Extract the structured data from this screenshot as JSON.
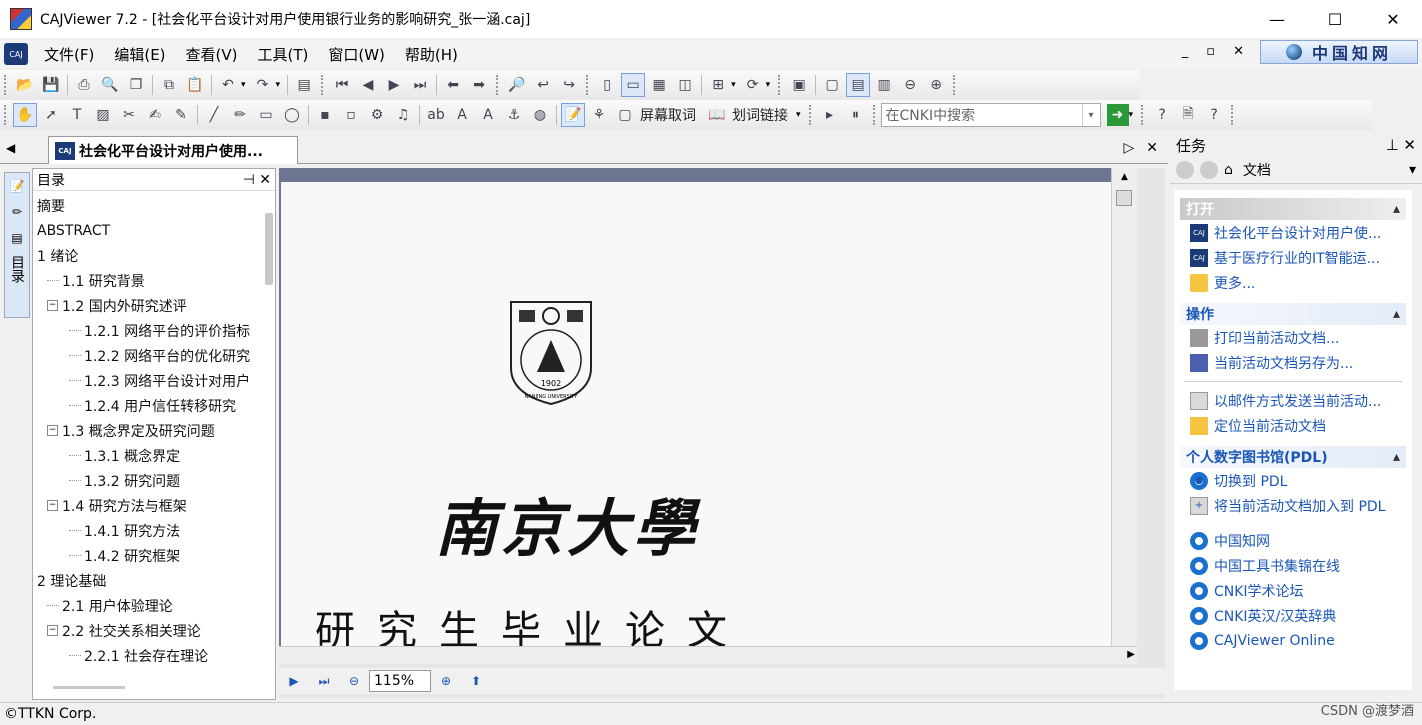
{
  "window": {
    "title": "CAJViewer 7.2 - [社会化平台设计对用户使用银行业务的影响研究_张一涵.caj]",
    "controls": [
      "—",
      "☐",
      "✕"
    ]
  },
  "menu": {
    "items": [
      "文件(F)",
      "编辑(E)",
      "查看(V)",
      "工具(T)",
      "窗口(W)",
      "帮助(H)"
    ],
    "mdi_controls": [
      "_",
      "▫",
      "✕"
    ],
    "brand": "中国知网"
  },
  "toolbar2": {
    "screen_select": "屏幕取词",
    "word_link": "划词链接",
    "search_placeholder": "在CNKI中搜索"
  },
  "doc_tab": {
    "title": "社会化平台设计对用户使用...",
    "icon_text": "CAJ"
  },
  "side_tabs": {
    "toc_label": "目录"
  },
  "toc": {
    "title": "目录",
    "items": [
      {
        "label": "摘要",
        "level": 0
      },
      {
        "label": "ABSTRACT",
        "level": 0
      },
      {
        "label": "1 绪论",
        "level": 0
      },
      {
        "label": "1.1 研究背景",
        "level": 1
      },
      {
        "label": "1.2 国内外研究述评",
        "level": 1,
        "expander": "−"
      },
      {
        "label": "1.2.1 网络平台的评价指标",
        "level": 2
      },
      {
        "label": "1.2.2 网络平台的优化研究",
        "level": 2
      },
      {
        "label": "1.2.3 网络平台设计对用户",
        "level": 2
      },
      {
        "label": "1.2.4 用户信任转移研究",
        "level": 2
      },
      {
        "label": "1.3 概念界定及研究问题",
        "level": 1,
        "expander": "−"
      },
      {
        "label": "1.3.1 概念界定",
        "level": 2
      },
      {
        "label": "1.3.2 研究问题",
        "level": 2
      },
      {
        "label": "1.4 研究方法与框架",
        "level": 1,
        "expander": "−"
      },
      {
        "label": "1.4.1 研究方法",
        "level": 2
      },
      {
        "label": "1.4.2 研究框架",
        "level": 2
      },
      {
        "label": "2 理论基础",
        "level": 0
      },
      {
        "label": "2.1 用户体验理论",
        "level": 1
      },
      {
        "label": "2.2 社交关系相关理论",
        "level": 1,
        "expander": "−"
      },
      {
        "label": "2.2.1 社会存在理论",
        "level": 2
      }
    ]
  },
  "page": {
    "seal_year": "1902",
    "seal_ring_text": "NANJING UNIVERSITY",
    "university": "南京大學",
    "doc_type": "研究生毕业论文"
  },
  "navbar": {
    "zoom": "115%"
  },
  "task_pane": {
    "title": "任务",
    "nav_label": "文档",
    "sections": [
      {
        "title": "打开",
        "style": "open",
        "items": [
          {
            "label": "社会化平台设计对用户使...",
            "icon": "caj-doc-icon"
          },
          {
            "label": "基于医疗行业的IT智能运...",
            "icon": "caj-doc-icon"
          },
          {
            "label": "更多...",
            "icon": "folder-icon"
          }
        ]
      },
      {
        "title": "操作",
        "style": "blue",
        "items": [
          {
            "label": "打印当前活动文档...",
            "icon": "print-icon"
          },
          {
            "label": "当前活动文档另存为...",
            "icon": "save-icon"
          },
          {
            "label": "---"
          },
          {
            "label": "以邮件方式发送当前活动...",
            "icon": "mail-icon"
          },
          {
            "label": "定位当前活动文档",
            "icon": "locate-folder-icon"
          }
        ]
      },
      {
        "title": "个人数字图书馆(PDL)",
        "style": "blue",
        "items": [
          {
            "label": "切换到 PDL",
            "icon": "pdl-switch-icon"
          },
          {
            "label": "将当前活动文档加入到 PDL",
            "icon": "pdl-add-icon"
          }
        ]
      },
      {
        "title": "",
        "style": "none",
        "items": [
          {
            "label": "中国知网",
            "icon": "ie-link-icon"
          },
          {
            "label": "中国工具书集锦在线",
            "icon": "ie-link-icon"
          },
          {
            "label": "CNKI学术论坛",
            "icon": "ie-link-icon"
          },
          {
            "label": "CNKI英汉/汉英辞典",
            "icon": "ie-link-icon"
          },
          {
            "label": "CAJViewer Online",
            "icon": "ie-link-icon"
          }
        ]
      }
    ]
  },
  "status": {
    "text": "©TTKN Corp.",
    "watermark": "CSDN @渡梦酒"
  }
}
